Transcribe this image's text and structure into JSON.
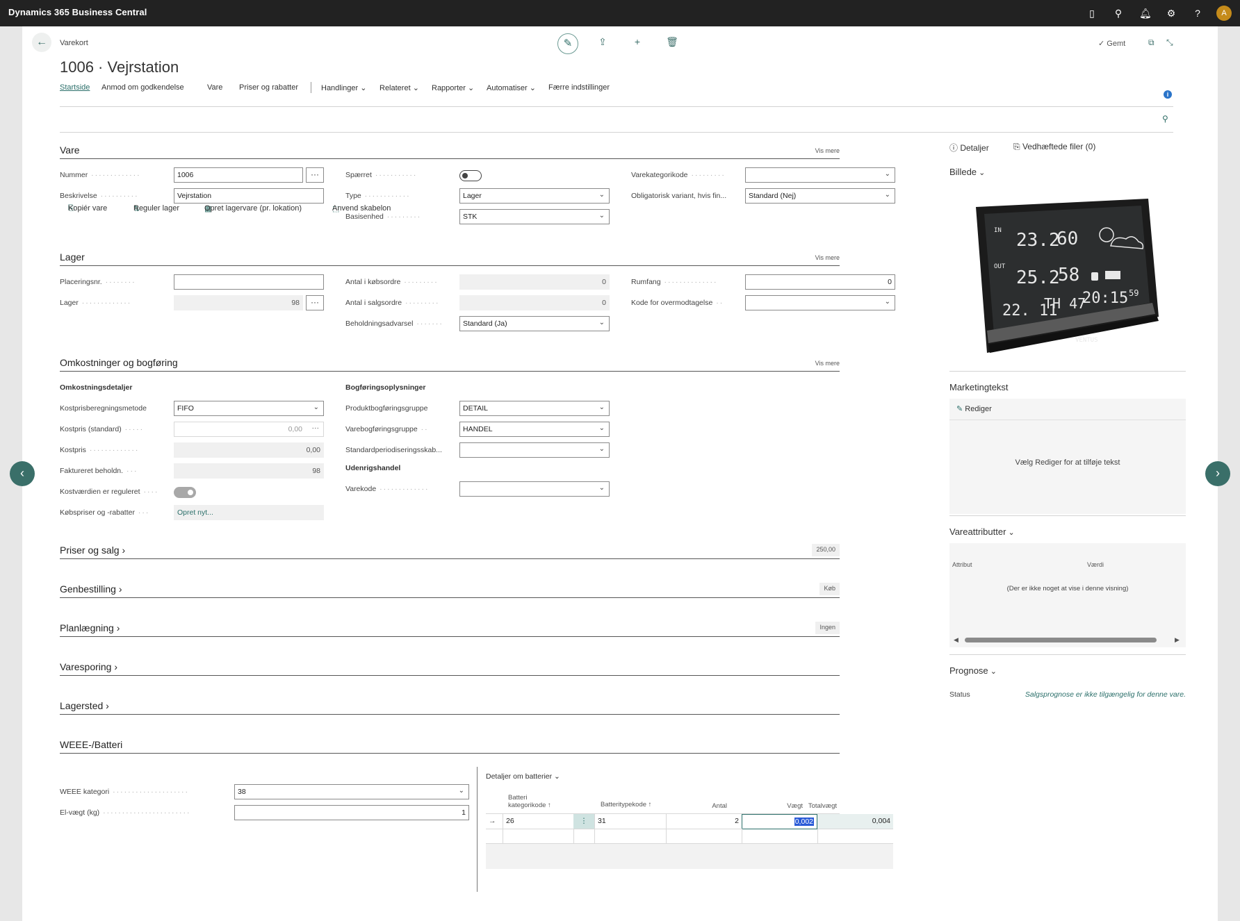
{
  "topbar": {
    "app_title": "Dynamics 365 Business Central",
    "avatar_initial": "A"
  },
  "header": {
    "kicker": "Varekort",
    "title": "1006 · Vejrstation",
    "saved_label": "Gemt"
  },
  "menu": {
    "items": [
      "Startside",
      "Anmod om godkendelse",
      "Vare",
      "Priser og rabatter",
      "Handlinger",
      "Relateret",
      "Rapporter",
      "Automatiser",
      "Færre indstillinger"
    ]
  },
  "actions": {
    "items": [
      "Kopiér vare",
      "Reguler lager",
      "Opret lagervare (pr. lokation)",
      "Anvend skabelon"
    ]
  },
  "vare": {
    "title": "Vare",
    "more": "Vis mere",
    "nummer_label": "Nummer",
    "nummer_value": "1006",
    "beskrivelse_label": "Beskrivelse",
    "beskrivelse_value": "Vejrstation",
    "spaerret_label": "Spærret",
    "type_label": "Type",
    "type_value": "Lager",
    "basisenhed_label": "Basisenhed",
    "basisenhed_value": "STK",
    "varekategori_label": "Varekategorikode",
    "varekategori_value": "",
    "obl_variant_label": "Obligatorisk variant, hvis fin...",
    "obl_variant_value": "Standard (Nej)"
  },
  "lager": {
    "title": "Lager",
    "more": "Vis mere",
    "placering_label": "Placeringsnr.",
    "placering_value": "",
    "lager_label": "Lager",
    "lager_value": "98",
    "koebsordre_label": "Antal i købsordre",
    "koebsordre_value": "0",
    "salgsordre_label": "Antal i salgsordre",
    "salgsordre_value": "0",
    "beholdning_label": "Beholdningsadvarsel",
    "beholdning_value": "Standard (Ja)",
    "rumfang_label": "Rumfang",
    "rumfang_value": "0",
    "overmod_label": "Kode for overmodtagelse",
    "overmod_value": ""
  },
  "omk": {
    "title": "Omkostninger og bogføring",
    "more": "Vis mere",
    "sub1": "Omkostningsdetaljer",
    "metode_label": "Kostprisberegningsmetode",
    "metode_value": "FIFO",
    "kost_std_label": "Kostpris (standard)",
    "kost_std_value": "0,00",
    "kostpris_label": "Kostpris",
    "kostpris_value": "0,00",
    "fakt_label": "Faktureret beholdn.",
    "fakt_value": "98",
    "reguleret_label": "Kostværdien er reguleret",
    "koebspriser_label": "Købspriser og -rabatter",
    "koebspriser_value": "Opret nyt...",
    "sub2": "Bogføringsoplysninger",
    "produkt_label": "Produktbogføringsgruppe",
    "produkt_value": "DETAIL",
    "varebog_label": "Varebogføringsgruppe",
    "varebog_value": "HANDEL",
    "periode_label": "Standardperiodiseringsskab...",
    "periode_value": "",
    "sub3": "Udenrigshandel",
    "varekode_label": "Varekode",
    "varekode_value": ""
  },
  "collapsed": {
    "priser": "Priser og salg",
    "priser_badge": "250,00",
    "genbestilling": "Genbestilling",
    "genbestilling_badge": "Køb",
    "planlaegning": "Planlægning",
    "planlaegning_badge": "Ingen",
    "varesporing": "Varesporing",
    "lagersted": "Lagersted"
  },
  "weee": {
    "title": "WEEE-/Batteri",
    "kategori_label": "WEEE kategori",
    "kategori_value": "38",
    "elvaegt_label": "El-vægt (kg)",
    "elvaegt_value": "1",
    "details_title": "Detaljer om batterier",
    "col1_line1": "Batteri",
    "col1_line2": "kategorikode ↑",
    "col2": "Batteritypekode ↑",
    "col3": "Antal",
    "col4": "Vægt",
    "col5": "Totalvægt",
    "row": {
      "kategori": "26",
      "type": "31",
      "antal": "2",
      "vaegt": "0,002",
      "total": "0,004"
    }
  },
  "factbox": {
    "tab1": "Detaljer",
    "tab2": "Vedhæftede filer (0)",
    "billede": "Billede",
    "marketing": "Marketingtekst",
    "rediger": "Rediger",
    "marketing_empty": "Vælg Rediger for at tilføje tekst",
    "vareattr": "Vareattributter",
    "attr_col1": "Attribut",
    "attr_col2": "Værdi",
    "attr_empty": "(Der er ikke noget at vise i denne visning)",
    "prognose": "Prognose",
    "status_label": "Status",
    "status_value": "Salgsprognose er ikke tilgængelig for denne vare."
  },
  "device": {
    "in": "IN",
    "out": "OUT",
    "t1": "23.2",
    "h1": "60",
    "t2": "25.2",
    "h2": "58",
    "date": "22. 11",
    "day": "TH 47",
    "time": "20:15",
    "sec": "59",
    "brand": "VENTUS"
  }
}
